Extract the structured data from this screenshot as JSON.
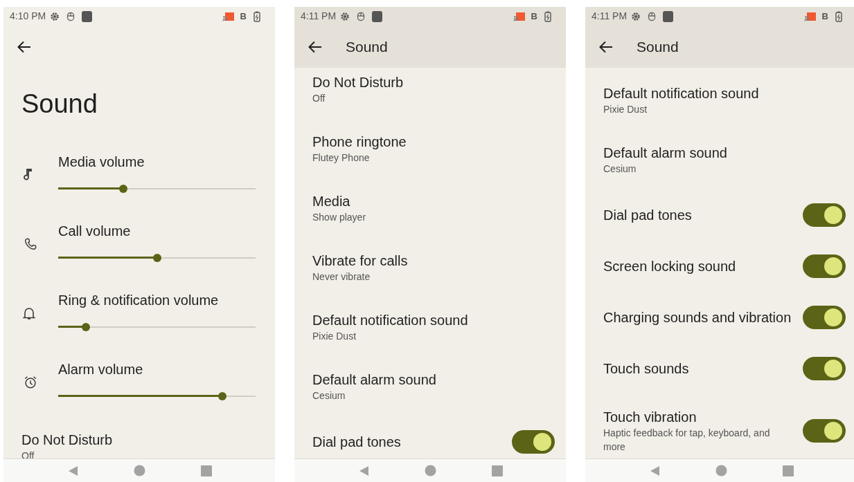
{
  "screens": [
    {
      "status_bar": {
        "time": "4:10 PM",
        "indicator": "B"
      },
      "header": {
        "title": "Sound"
      },
      "items": [
        {
          "kind": "slider",
          "label": "Media volume",
          "level": 0.33
        },
        {
          "kind": "slider",
          "label": "Call volume",
          "level": 0.5
        },
        {
          "kind": "slider",
          "label": "Ring & notification volume",
          "level": 0.14
        },
        {
          "kind": "slider",
          "label": "Alarm volume",
          "level": 0.83
        },
        {
          "kind": "entry",
          "title": "Do Not Disturb",
          "summary": "Off"
        }
      ]
    },
    {
      "status_bar": {
        "time": "4:11 PM",
        "indicator": "B"
      },
      "toolbar": {
        "title": "Sound"
      },
      "items": [
        {
          "kind": "entry",
          "title": "Do Not Disturb",
          "summary": "Off"
        },
        {
          "kind": "entry",
          "title": "Phone ringtone",
          "summary": "Flutey Phone"
        },
        {
          "kind": "entry",
          "title": "Media",
          "summary": "Show player"
        },
        {
          "kind": "entry",
          "title": "Vibrate for calls",
          "summary": "Never vibrate"
        },
        {
          "kind": "entry",
          "title": "Default notification sound",
          "summary": "Pixie Dust"
        },
        {
          "kind": "entry",
          "title": "Default alarm sound",
          "summary": "Cesium"
        },
        {
          "kind": "switch",
          "title": "Dial pad tones",
          "on": true
        }
      ]
    },
    {
      "status_bar": {
        "time": "4:11 PM",
        "indicator": "B"
      },
      "toolbar": {
        "title": "Sound"
      },
      "items": [
        {
          "kind": "entry",
          "title": "Default notification sound",
          "summary": "Pixie Dust"
        },
        {
          "kind": "entry",
          "title": "Default alarm sound",
          "summary": "Cesium"
        },
        {
          "kind": "switch",
          "title": "Dial pad tones",
          "on": true
        },
        {
          "kind": "switch",
          "title": "Screen locking sound",
          "on": true
        },
        {
          "kind": "switch",
          "title": "Charging sounds and vibration",
          "on": true
        },
        {
          "kind": "switch",
          "title": "Touch sounds",
          "on": true
        },
        {
          "kind": "switch",
          "title": "Touch vibration",
          "summary": "Haptic feedback for tap, keyboard, and more",
          "on": true
        }
      ]
    }
  ]
}
